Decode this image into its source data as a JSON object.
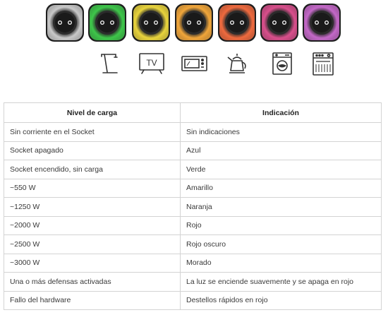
{
  "sockets": [
    {
      "id": "gray",
      "glow": "#c9c9c9"
    },
    {
      "id": "green",
      "glow": "#3ec64a"
    },
    {
      "id": "yellow",
      "glow": "#e9d43c"
    },
    {
      "id": "orange",
      "glow": "#f1a63a"
    },
    {
      "id": "red",
      "glow": "#ef6a3e"
    },
    {
      "id": "pink",
      "glow": "#d94f8c"
    },
    {
      "id": "purple",
      "glow": "#c468c8"
    }
  ],
  "appliances": [
    {
      "icon": "desk-lamp-icon"
    },
    {
      "icon": "tv-icon",
      "label": "TV"
    },
    {
      "icon": "microwave-icon"
    },
    {
      "icon": "kettle-icon"
    },
    {
      "icon": "washing-machine-icon"
    },
    {
      "icon": "dishwasher-icon"
    }
  ],
  "table": {
    "headers": [
      "Nivel de carga",
      "Indicación"
    ],
    "rows": [
      [
        "Sin corriente en el Socket",
        "Sin indicaciones"
      ],
      [
        "Socket apagado",
        "Azul"
      ],
      [
        "Socket encendido, sin carga",
        "Verde"
      ],
      [
        "~550 W",
        "Amarillo"
      ],
      [
        "~1250 W",
        "Naranja"
      ],
      [
        "~2000 W",
        "Rojo"
      ],
      [
        "~2500 W",
        "Rojo oscuro"
      ],
      [
        "~3000 W",
        "Morado"
      ],
      [
        "Una o más defensas activadas",
        "La luz se enciende suavemente y se apaga en rojo"
      ],
      [
        "Fallo del hardware",
        "Destellos rápidos en rojo"
      ]
    ]
  }
}
